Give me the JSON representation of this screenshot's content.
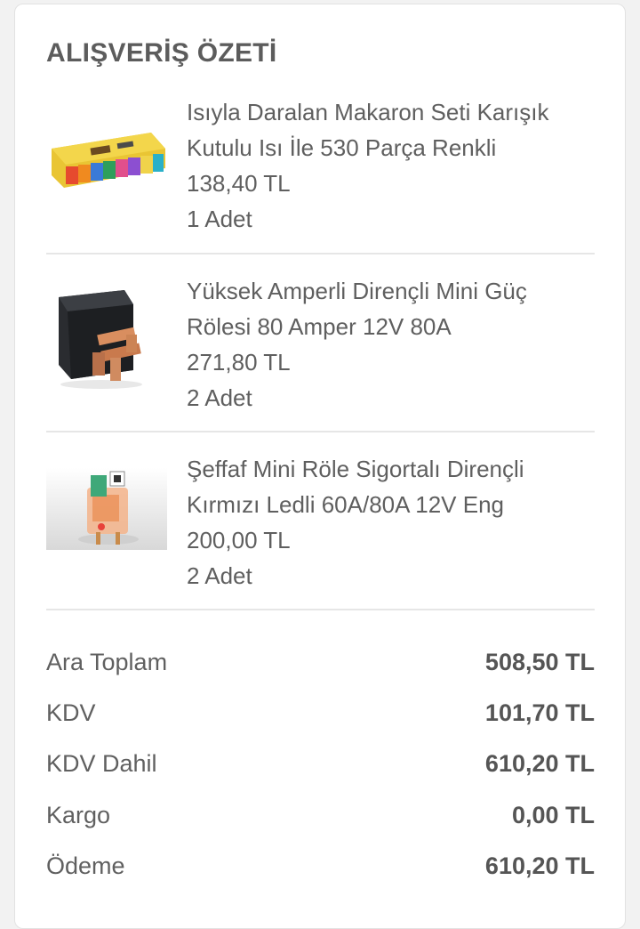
{
  "summary_title": "ALIŞVERİŞ ÖZETİ",
  "items": [
    {
      "name_line1": "Isıyla Daralan Makaron Seti Karışık",
      "name_line2": "Kutulu Isı İle 530 Parça Renkli",
      "price": "138,40 TL",
      "quantity": "1 Adet"
    },
    {
      "name_line1": "Yüksek Amperli Dirençli Mini Güç",
      "name_line2": "Rölesi 80 Amper 12V 80A",
      "price": "271,80 TL",
      "quantity": "2 Adet"
    },
    {
      "name_line1": "Şeffaf Mini Röle Sigortalı Dirençli",
      "name_line2": "Kırmızı Ledli 60A/80A 12V Eng",
      "price": "200,00 TL",
      "quantity": "2 Adet"
    }
  ],
  "totals": [
    {
      "label": "Ara Toplam",
      "value": "508,50 TL"
    },
    {
      "label": "KDV",
      "value": "101,70 TL"
    },
    {
      "label": "KDV Dahil",
      "value": "610,20 TL"
    },
    {
      "label": "Kargo",
      "value": "0,00 TL"
    },
    {
      "label": "Ödeme",
      "value": "610,20 TL"
    }
  ]
}
